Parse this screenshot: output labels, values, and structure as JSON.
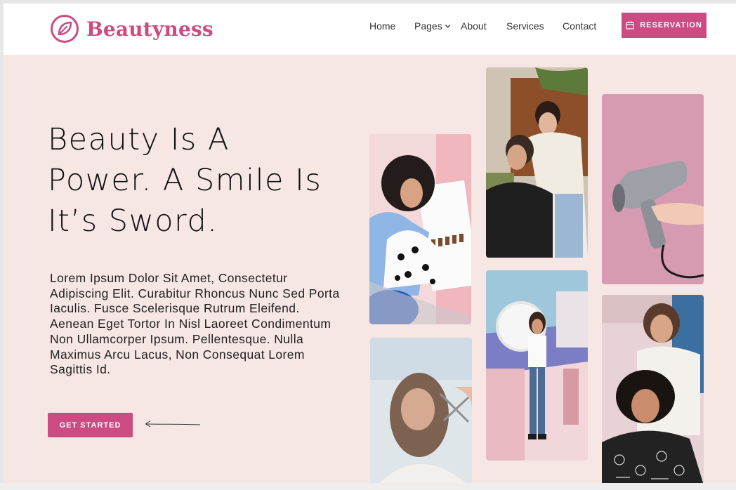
{
  "brand": {
    "name": "Beautyness"
  },
  "nav": {
    "home": "Home",
    "pages": "Pages",
    "about": "About",
    "services": "Services",
    "contact": "Contact",
    "reservation": "RESERVATION"
  },
  "hero": {
    "headline": "Beauty Is A Power. A Smile Is It’s Sword.",
    "body": "Lorem Ipsum Dolor Sit Amet, Consectetur Adipiscing Elit. Curabitur Rhoncus Nunc Sed Porta Iaculis. Fusce Scelerisque Rutrum Eleifend. Aenean Eget Tortor In Nisl Laoreet Condimentum Non Ullamcorper Ipsum. Pellentesque. Nulla Maximus Arcu Lacus, Non Consequat Lorem Sagittis Id.",
    "cta": "GET STARTED"
  },
  "colors": {
    "accent": "#cc4b82",
    "hero_bg": "#f6e6e4",
    "header_bg": "#ffffff"
  },
  "icons": [
    "leaf-logo-icon",
    "chevron-down-icon",
    "calendar-icon",
    "arrow-left-icon"
  ]
}
